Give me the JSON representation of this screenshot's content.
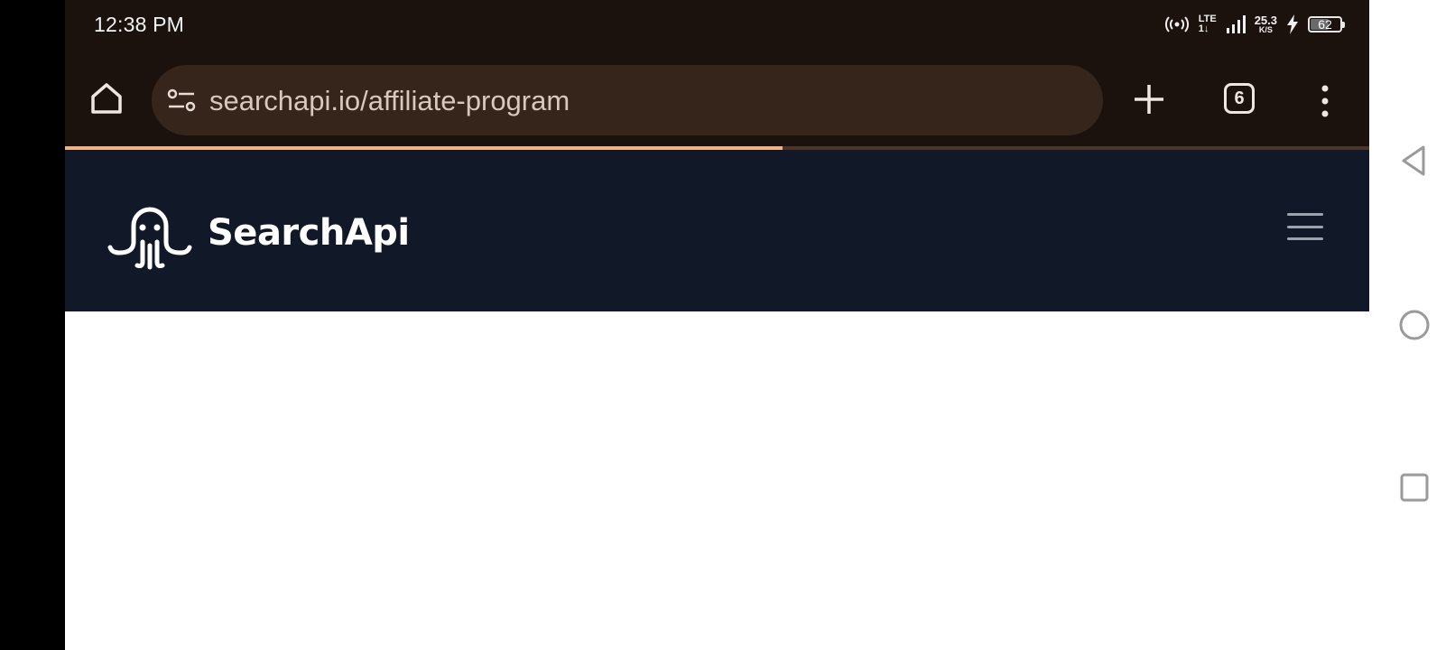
{
  "status_bar": {
    "time": "12:38 PM",
    "network": "LTE",
    "network_sub": "1↓",
    "speed_value": "25.3",
    "speed_unit": "K/S",
    "battery": "62"
  },
  "browser": {
    "url": "searchapi.io/affiliate-program",
    "tab_count": "6",
    "load_progress": 0.55,
    "icons": [
      "home-icon",
      "site-settings-icon",
      "plus-icon",
      "tabs-icon",
      "more-vert-icon"
    ]
  },
  "site": {
    "brand": "SearchApi",
    "icons": [
      "octopus-logo-icon",
      "hamburger-menu-icon"
    ]
  },
  "nav": {
    "icons": [
      "back-triangle-icon",
      "home-circle-icon",
      "recents-square-icon"
    ]
  },
  "colors": {
    "browser_chrome": "#1b120e",
    "url_bar": "#36251a",
    "progress": "#f3b38a",
    "site_header": "#111827",
    "page_bg": "#ffffff"
  }
}
